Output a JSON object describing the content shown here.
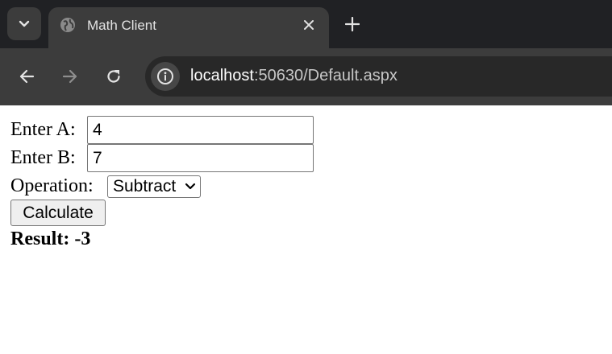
{
  "browser": {
    "tab_title": "Math Client",
    "url_host": "localhost",
    "url_rest": ":50630/Default.aspx"
  },
  "form": {
    "label_a": "Enter A:",
    "value_a": "4",
    "label_b": "Enter B:",
    "value_b": "7",
    "label_op": "Operation:",
    "operation": "Subtract",
    "calculate_label": "Calculate",
    "result_label": "Result:",
    "result_value": "-3"
  }
}
